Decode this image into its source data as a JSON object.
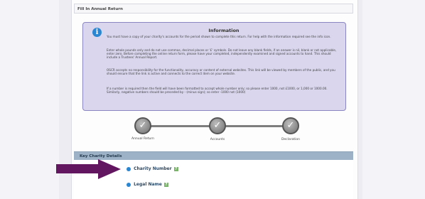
{
  "page": {
    "header_title": "Fill In Annual Return"
  },
  "info": {
    "title": "Information",
    "paragraphs": [
      "You must have a copy of your charity's accounts for the period shown to complete this return. For help with the information required see the info icon.",
      "Enter whole pounds only and do not use commas, decimal places or '£' symbols. Do not leave any blank fields, if an answer is nil, blank or not applicable, enter zero. Before completing the online return form, please have your completed, independently examined and signed accounts to hand. This should include a Trustees' Annual Report.",
      "OSCR accepts no responsibility for the functionality, accuracy or content of external websites. This link will be viewed by members of the public, and you should ensure that the link is active and connects to the correct item on your website.",
      "If a number is required then the field will have been formatted to accept whole number only; so please enter 1000, not £1000, or 1,000 or 1000.00. Similarly, negative numbers should be preceded by - (minus sign); so enter -1000 not (1000)"
    ]
  },
  "progress": {
    "steps": [
      {
        "label": "Annual Return"
      },
      {
        "label": "Accounts"
      },
      {
        "label": "Declaration"
      }
    ]
  },
  "section": {
    "title": "Key Charity Details",
    "fields": [
      {
        "label": "Charity Number"
      },
      {
        "label": "Legal Name"
      }
    ]
  }
}
